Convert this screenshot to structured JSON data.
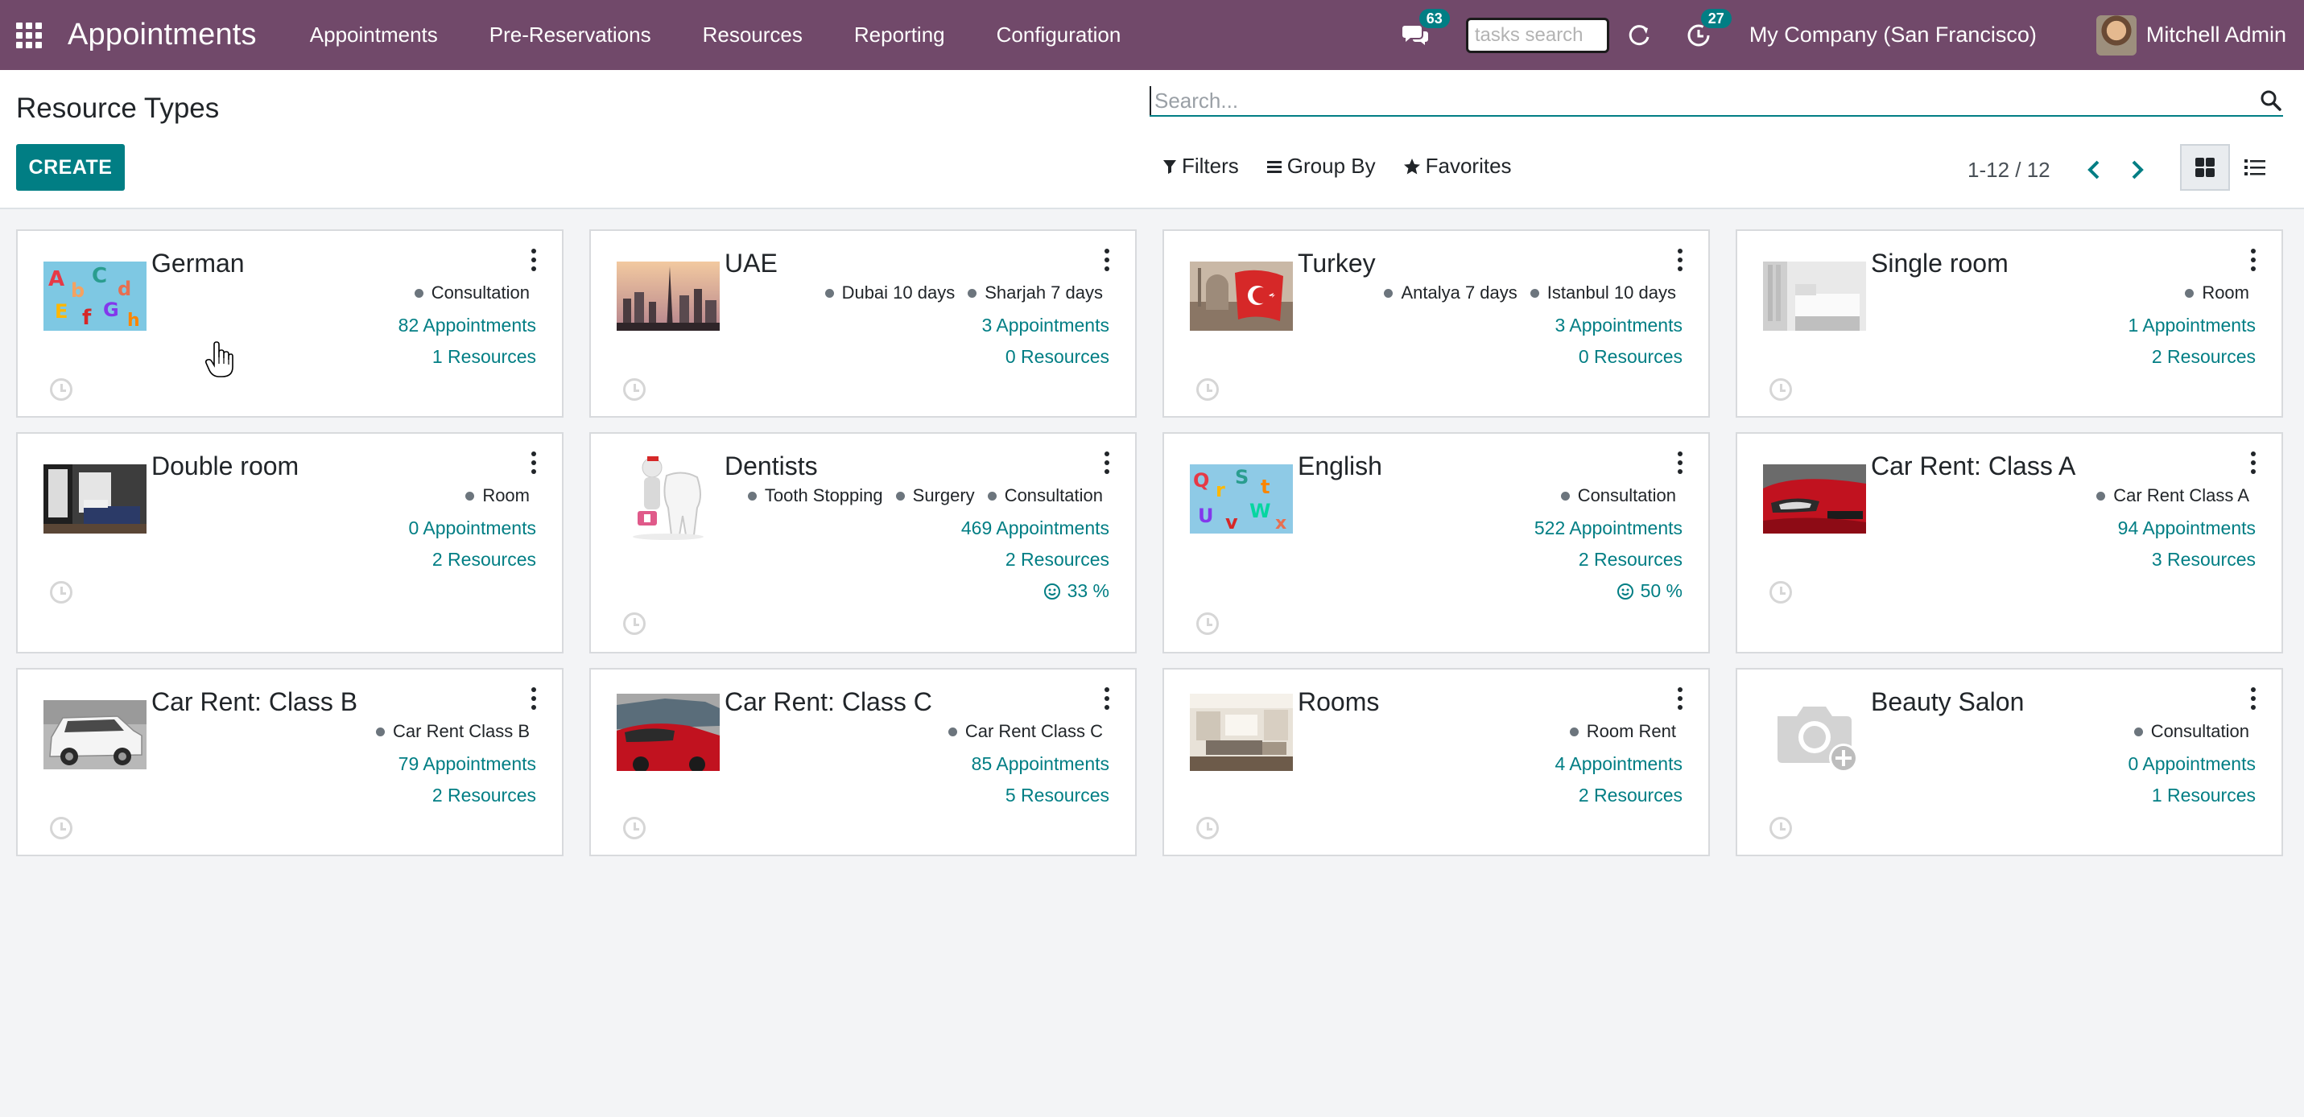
{
  "navbar": {
    "brand": "Appointments",
    "menu": [
      "Appointments",
      "Pre-Reservations",
      "Resources",
      "Reporting",
      "Configuration"
    ],
    "messages_count": "63",
    "tasks_search_placeholder": "tasks search",
    "activities_count": "27",
    "company": "My Company (San Francisco)",
    "user": "Mitchell Admin"
  },
  "control_panel": {
    "title": "Resource Types",
    "create_label": "CREATE",
    "search_placeholder": "Search...",
    "filters_label": "Filters",
    "group_by_label": "Group By",
    "favorites_label": "Favorites",
    "pager": "1-12 / 12"
  },
  "colors": {
    "navbar": "#71496a",
    "accent": "#017e84"
  },
  "cards": [
    {
      "title": "German",
      "tags": [
        "Consultation"
      ],
      "appointments": "82 Appointments",
      "resources": "1 Resources",
      "image": "alphabet-letters"
    },
    {
      "title": "UAE",
      "tags": [
        "Dubai 10 days",
        "Sharjah 7 days"
      ],
      "appointments": "3 Appointments",
      "resources": "0 Resources",
      "image": "dubai-skyline"
    },
    {
      "title": "Turkey",
      "tags": [
        "Antalya 7 days",
        "Istanbul 10 days"
      ],
      "appointments": "3 Appointments",
      "resources": "0 Resources",
      "image": "turkish-flag-mosque"
    },
    {
      "title": "Single room",
      "tags": [
        "Room"
      ],
      "appointments": "1 Appointments",
      "resources": "2 Resources",
      "image": "single-bedroom"
    },
    {
      "title": "Double room",
      "tags": [
        "Room"
      ],
      "appointments": "0 Appointments",
      "resources": "2 Resources",
      "image": "double-bedroom"
    },
    {
      "title": "Dentists",
      "tags": [
        "Tooth Stopping",
        "Surgery",
        "Consultation"
      ],
      "appointments": "469 Appointments",
      "resources": "2 Resources",
      "rating": "33 %",
      "image": "dentist-tooth"
    },
    {
      "title": "English",
      "tags": [
        "Consultation"
      ],
      "appointments": "522 Appointments",
      "resources": "2 Resources",
      "rating": "50 %",
      "image": "alphabet-letters"
    },
    {
      "title": "Car Rent: Class A",
      "tags": [
        "Car Rent Class A"
      ],
      "appointments": "94 Appointments",
      "resources": "3 Resources",
      "image": "red-car"
    },
    {
      "title": "Car Rent: Class B",
      "tags": [
        "Car Rent Class B"
      ],
      "appointments": "79 Appointments",
      "resources": "2 Resources",
      "image": "white-suv"
    },
    {
      "title": "Car Rent: Class C",
      "tags": [
        "Car Rent Class C"
      ],
      "appointments": "85 Appointments",
      "resources": "5 Resources",
      "image": "red-sedan"
    },
    {
      "title": "Rooms",
      "tags": [
        "Room Rent"
      ],
      "appointments": "4 Appointments",
      "resources": "2 Resources",
      "image": "living-room"
    },
    {
      "title": "Beauty Salon",
      "tags": [
        "Consultation"
      ],
      "appointments": "0 Appointments",
      "resources": "1 Resources",
      "image": "camera-placeholder"
    }
  ]
}
